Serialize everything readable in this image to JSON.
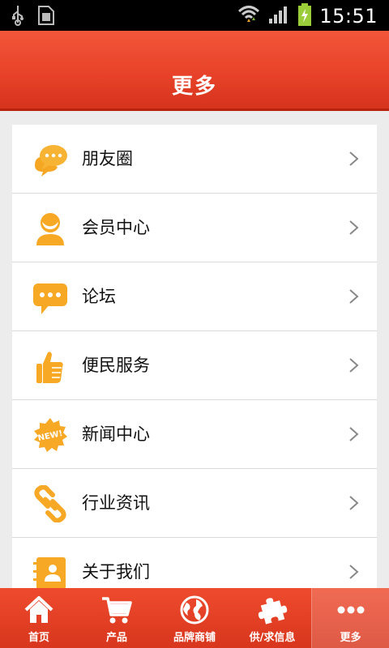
{
  "status_bar": {
    "time": "15:51"
  },
  "header": {
    "title": "更多"
  },
  "menu": {
    "items": [
      {
        "label": "朋友圈",
        "icon": "chat-bubbles-icon"
      },
      {
        "label": "会员中心",
        "icon": "member-icon"
      },
      {
        "label": "论坛",
        "icon": "forum-icon"
      },
      {
        "label": "便民服务",
        "icon": "thumbs-up-icon"
      },
      {
        "label": "新闻中心",
        "icon": "new-badge-icon"
      },
      {
        "label": "行业资讯",
        "icon": "link-icon"
      },
      {
        "label": "关于我们",
        "icon": "contact-card-icon"
      }
    ]
  },
  "tabbar": {
    "tabs": [
      {
        "label": "首页",
        "icon": "home-icon"
      },
      {
        "label": "产品",
        "icon": "cart-icon"
      },
      {
        "label": "品牌商铺",
        "icon": "globe-icon"
      },
      {
        "label": "供/求信息",
        "icon": "puzzle-icon"
      },
      {
        "label": "更多",
        "icon": "more-dots-icon",
        "active": true
      }
    ]
  },
  "colors": {
    "accent": "#e8432a",
    "icon": "#f7a824",
    "background": "#ececec"
  }
}
